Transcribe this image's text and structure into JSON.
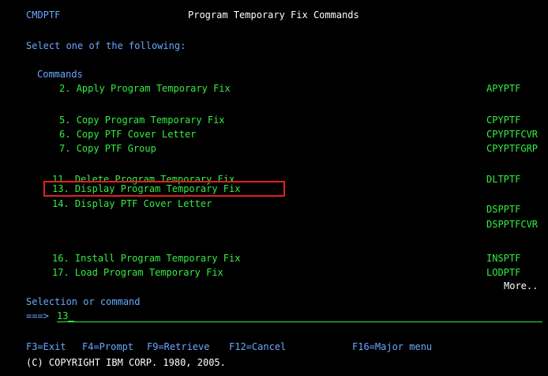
{
  "header": {
    "screen_name": "CMDPTF",
    "title": "Program Temporary Fix Commands"
  },
  "prompt": "Select one of the following:",
  "section_label": "Commands",
  "options": [
    {
      "num": "2.",
      "label": "Apply Program Temporary Fix",
      "command": "APYPTF"
    },
    {
      "num": "5.",
      "label": "Copy Program Temporary Fix",
      "command": "CPYPTF"
    },
    {
      "num": "6.",
      "label": "Copy PTF Cover Letter",
      "command": "CPYPTFCVR"
    },
    {
      "num": "7.",
      "label": "Copy PTF Group",
      "command": "CPYPTFGRP"
    },
    {
      "num": "11.",
      "label": "Delete Program Temporary Fix",
      "command": "DLTPTF"
    },
    {
      "num": "13.",
      "label": "Display Program Temporary Fix",
      "command": "DSPPTF"
    },
    {
      "num": "14.",
      "label": "Display PTF Cover Letter",
      "command": "DSPPTFCVR"
    },
    {
      "num": "16.",
      "label": "Install Program Temporary Fix",
      "command": "INSPTF"
    },
    {
      "num": "17.",
      "label": "Load Program Temporary Fix",
      "command": "LODPTF"
    }
  ],
  "more_indicator": "More..",
  "selection": {
    "label": "Selection or command",
    "arrow": "===>",
    "value": "13"
  },
  "function_keys": [
    "F3=Exit",
    "F4=Prompt",
    "F9=Retrieve",
    "F12=Cancel",
    "F16=Major menu"
  ],
  "copyright": "(C) COPYRIGHT IBM CORP. 1980, 2005.",
  "colors": {
    "background": "#000000",
    "blue": "#6aa7ff",
    "green": "#33ee44",
    "white": "#ffffff",
    "highlight_border": "#e0201c"
  }
}
